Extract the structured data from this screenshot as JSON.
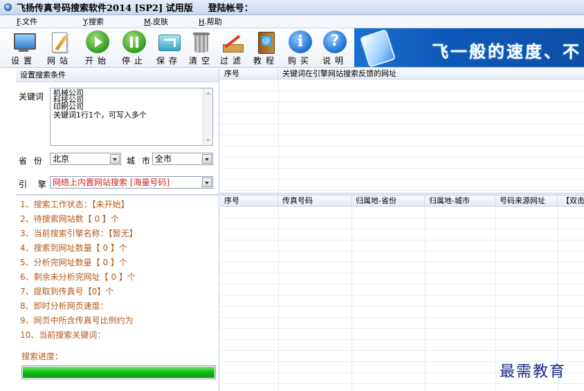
{
  "window": {
    "title": "飞扬传真号码搜索软件2014 [SP2] 试用版",
    "account_label": "登陆帐号："
  },
  "menu": [
    {
      "key": "F",
      "label": ".文件"
    },
    {
      "key": "Y",
      "label": ".搜索"
    },
    {
      "key": "M",
      "label": ".皮肤"
    },
    {
      "key": "H",
      "label": ".帮助"
    }
  ],
  "toolbar": {
    "tools": [
      {
        "label": "设置",
        "icon": "monitor-icon"
      },
      {
        "label": "网站",
        "icon": "document-pen-icon"
      },
      {
        "label": "开始",
        "icon": "play-icon"
      },
      {
        "label": "停止",
        "icon": "pause-icon"
      },
      {
        "label": "保存",
        "icon": "save-arrow-icon"
      },
      {
        "label": "清空",
        "icon": "trash-icon"
      },
      {
        "label": "过滤",
        "icon": "filter-pencil-icon"
      },
      {
        "label": "教程",
        "icon": "book-icon"
      },
      {
        "label": "购买",
        "icon": "info-icon"
      },
      {
        "label": "说明",
        "icon": "help-icon"
      }
    ],
    "banner_slogan": "飞一般的速度、不"
  },
  "search_settings": {
    "header": "设置搜索条件",
    "keyword_label": "关键词",
    "keywords": [
      "机械公司",
      "科技公司",
      "印刷公司",
      "关键词1行1个，可写入多个"
    ],
    "province_label": "省 份",
    "province_value": "北京",
    "city_label": "城 市",
    "city_value": "全市",
    "engine_label": "引 擎",
    "engine_value": "网络上内置网站搜索 [海量号码]"
  },
  "status": {
    "lines": [
      "1、搜索工作状态：【未开始】",
      "2、待搜索网站数【 0 】个",
      "3、当前搜索引擎名称：【暂无】",
      "4、搜索到网址数量【 0 】个",
      "5、分析完网址数量【 0 】个",
      "6、剩余未分析完网址【 0 】个",
      "7、提取到传真号【0】个",
      "8、即时分析网页速度：",
      "9、网页中所含传真号比例约为",
      "10、当前搜索关键词："
    ],
    "progress_label": "搜索进度：",
    "progress": 1.0
  },
  "url_grid": {
    "columns": [
      "序号",
      "关键词在引擎网站搜索反馈的网址"
    ]
  },
  "result_grid": {
    "columns": [
      "序号",
      "传真号码",
      "归属地-省份",
      "归属地-城市",
      "号码来源网址",
      "【双击"
    ]
  },
  "watermark": "最需教育",
  "colors": {
    "status_text": "#b5581a",
    "engine_text": "#d42020",
    "progress_fill": "#14b814",
    "banner": "#1a6fd0"
  }
}
